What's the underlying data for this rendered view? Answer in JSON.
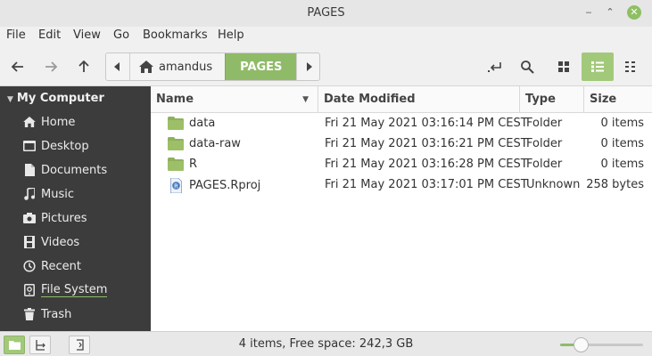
{
  "window": {
    "title": "PAGES",
    "minimize_glyph": "‒",
    "maximize_glyph": "⌃",
    "close_glyph": "✕"
  },
  "menu": [
    "File",
    "Edit",
    "View",
    "Go",
    "Bookmarks",
    "Help"
  ],
  "toolbar": {
    "back": "back-arrow-icon",
    "forward": "forward-arrow-icon",
    "up": "up-arrow-icon",
    "path": {
      "home_label": "amandus",
      "current_label": "PAGES"
    },
    "view_mode": "list"
  },
  "sidebar": {
    "section": "My Computer",
    "items": [
      {
        "label": "Home",
        "icon": "home-icon"
      },
      {
        "label": "Desktop",
        "icon": "desktop-icon"
      },
      {
        "label": "Documents",
        "icon": "documents-icon"
      },
      {
        "label": "Music",
        "icon": "music-icon"
      },
      {
        "label": "Pictures",
        "icon": "pictures-icon"
      },
      {
        "label": "Videos",
        "icon": "videos-icon"
      },
      {
        "label": "Recent",
        "icon": "recent-icon"
      },
      {
        "label": "File System",
        "icon": "filesystem-icon"
      },
      {
        "label": "Trash",
        "icon": "trash-icon"
      }
    ]
  },
  "columns": {
    "name": "Name",
    "date": "Date Modified",
    "type": "Type",
    "size": "Size",
    "sort_glyph": "▼"
  },
  "files": [
    {
      "name": "data",
      "date": "Fri 21 May 2021 03:16:14 PM CEST",
      "type": "Folder",
      "size": "0 items",
      "icon": "folder-icon"
    },
    {
      "name": "data-raw",
      "date": "Fri 21 May 2021 03:16:21 PM CEST",
      "type": "Folder",
      "size": "0 items",
      "icon": "folder-icon"
    },
    {
      "name": "R",
      "date": "Fri 21 May 2021 03:16:28 PM CEST",
      "type": "Folder",
      "size": "0 items",
      "icon": "folder-icon"
    },
    {
      "name": "PAGES.Rproj",
      "date": "Fri 21 May 2021 03:17:01 PM CEST",
      "type": "Unknown",
      "size": "258 bytes",
      "icon": "rproj-file-icon"
    }
  ],
  "status": {
    "text": "4 items, Free space: 242,3 GB",
    "zoom_level": 0.2
  },
  "colors": {
    "accent": "#8fbb68",
    "sidebar_bg": "#3c3c3c",
    "folder": "#8fb05c"
  }
}
